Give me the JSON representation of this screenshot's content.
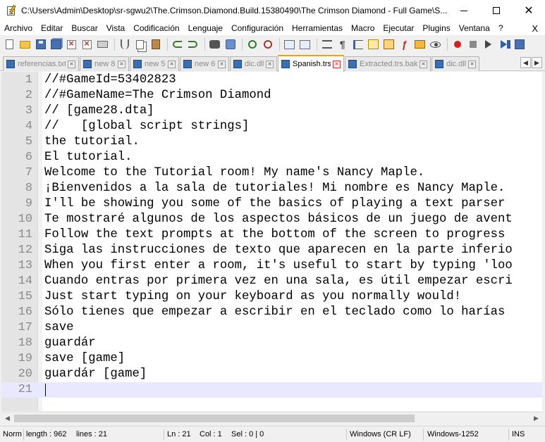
{
  "window": {
    "title": "C:\\Users\\Admin\\Desktop\\sr-sgwu2\\The.Crimson.Diamond.Build.15380490\\The Crimson Diamond - Full Game\\S..."
  },
  "menu": {
    "items": [
      "Archivo",
      "Editar",
      "Buscar",
      "Vista",
      "Codificación",
      "Lenguaje",
      "Configuración",
      "Herramientas",
      "Macro",
      "Ejecutar",
      "Plugins",
      "Ventana",
      "?"
    ],
    "close_glyph": "X"
  },
  "toolbar": {
    "icons": [
      "new-file-icon",
      "open-folder-icon",
      "save-icon",
      "save-all-icon",
      "close-icon",
      "close-all-icon",
      "print-icon",
      "cut-icon",
      "copy-icon",
      "paste-icon",
      "undo-icon",
      "redo-icon",
      "find-icon",
      "replace-icon",
      "zoom-in-icon",
      "zoom-out-icon",
      "sync-scroll-icon",
      "word-wrap-icon",
      "show-all-chars-icon",
      "indent-guide-icon",
      "user-language-icon",
      "fold-all-icon",
      "function-list-icon",
      "folder-as-workspace-icon",
      "monitoring-icon",
      "record-macro-icon",
      "stop-macro-icon",
      "play-macro-icon",
      "run-macro-multiple-icon",
      "save-macro-icon"
    ]
  },
  "tabs": [
    {
      "label": "referencias.txt",
      "active": false
    },
    {
      "label": "new 8",
      "active": false
    },
    {
      "label": "new 5",
      "active": false
    },
    {
      "label": "new 6",
      "active": false
    },
    {
      "label": "dic.dll",
      "active": false
    },
    {
      "label": "Spanish.trs",
      "active": true
    },
    {
      "label": "Extracted.trs.bak",
      "active": false
    },
    {
      "label": "dic.dll",
      "active": false
    }
  ],
  "tab_close_glyph": "×",
  "tab_scroll": {
    "left": "◀",
    "right": "▶"
  },
  "editor": {
    "current_line": 21,
    "lines": [
      "//#GameId=53402823",
      "//#GameName=The Crimson Diamond",
      "// [game28.dta]",
      "//   [global script strings]",
      "the tutorial.",
      "El tutorial.",
      "Welcome to the Tutorial room! My name's Nancy Maple.",
      "¡Bienvenidos a la sala de tutoriales! Mi nombre es Nancy Maple.",
      "I'll be showing you some of the basics of playing a text parser",
      "Te mostraré algunos de los aspectos básicos de un juego de avent",
      "Follow the text prompts at the bottom of the screen to progress",
      "Siga las instrucciones de texto que aparecen en la parte inferio",
      "When you first enter a room, it's useful to start by typing 'loo",
      "Cuando entras por primera vez en una sala, es útil empezar escri",
      "Just start typing on your keyboard as you normally would!",
      "Sólo tienes que empezar a escribir en el teclado como lo harías",
      "save",
      "guardár",
      "save [game]",
      "guardár [game]",
      ""
    ]
  },
  "scrollbar": {
    "left": "◀",
    "right": "▶"
  },
  "status": {
    "mode": "Norm",
    "length": "length : 962",
    "lines": "lines : 21",
    "ln": "Ln : 21",
    "col": "Col : 1",
    "sel": "Sel : 0 | 0",
    "eol": "Windows (CR LF)",
    "encoding": "Windows-1252",
    "ins": "INS"
  }
}
